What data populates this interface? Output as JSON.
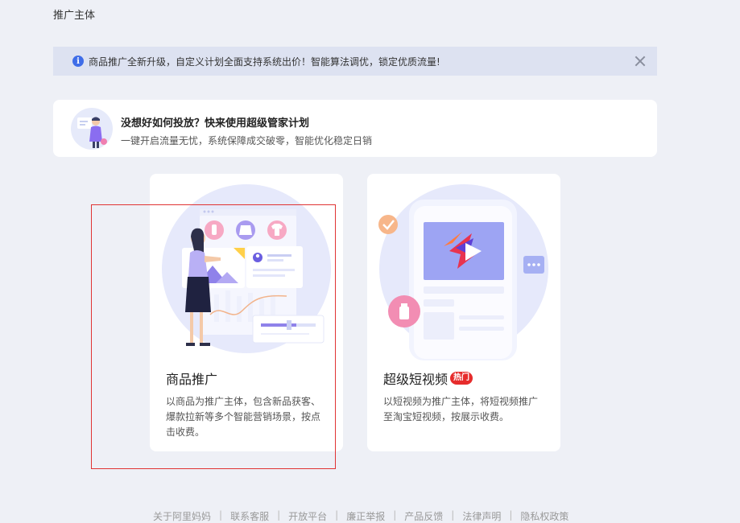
{
  "section_title": "推广主体",
  "notice": {
    "icon": "info-icon",
    "text": "商品推广全新升级，自定义计划全面支持系统出价！智能算法调优，锁定优质流量!",
    "close_icon": "close-icon"
  },
  "promo": {
    "title": "没想好如何投放？快来使用超级管家计划",
    "subtitle": "一键开启流量无忧，系统保障成交破零，智能优化稳定日销"
  },
  "cards": [
    {
      "title": "商品推广",
      "description": "以商品为推广主体，包含新品获客、爆款拉新等多个智能营销场景，按点击收费。",
      "selected": true
    },
    {
      "title": "超级短视频",
      "badge": "热门",
      "description": "以短视频为推广主体，将短视频推广至淘宝短视频，按展示收费。"
    }
  ],
  "footer": {
    "links": [
      "关于阿里妈妈",
      "联系客服",
      "开放平台",
      "廉正举报",
      "产品反馈",
      "法律声明",
      "隐私权政策"
    ]
  },
  "colors": {
    "page_bg": "#eef0f6",
    "notice_bg": "#dde2f1",
    "accent_blue": "#3f6de8",
    "hot_red": "#e62c2c",
    "highlight_red": "#e03333"
  }
}
